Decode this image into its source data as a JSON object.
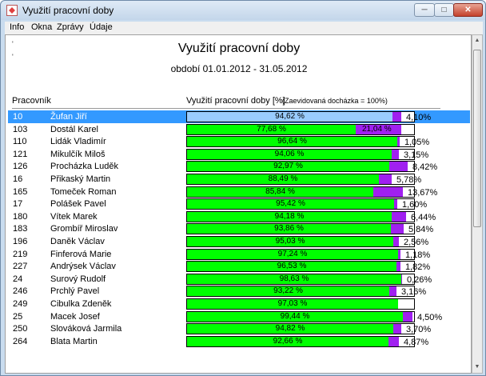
{
  "window": {
    "title": "Využití pracovní doby",
    "min_label": "─",
    "max_label": "□",
    "close_label": "✕"
  },
  "menu": {
    "items": [
      "Info",
      "Okna",
      "Zprávy",
      "Údaje"
    ]
  },
  "report": {
    "title": "Využití pracovní doby",
    "period": "období 01.01.2012 - 31.05.2012",
    "tick_marks": [
      "'",
      "'"
    ],
    "col_worker": "Pracovník",
    "col_usage": "Využití pracovní doby [%]",
    "col_note": "(Zaevidovaná docházka = 100%)"
  },
  "colors": {
    "worked": "#00ff00",
    "rest": "#a020f0",
    "selected_row": "#3399ff",
    "selected_bar": "#99ccff"
  },
  "rows": [
    {
      "id": "10",
      "name": "Žufan Jiří",
      "worked": 94.62,
      "worked_label": "94,62 %",
      "rest": 4.1,
      "rest_label": "4,10%",
      "rest_inside": "",
      "selected": true
    },
    {
      "id": "103",
      "name": "Dostál Karel",
      "worked": 77.68,
      "worked_label": "77,68 %",
      "rest": 21.04,
      "rest_label": "",
      "rest_inside": "21,04 %",
      "selected": false
    },
    {
      "id": "110",
      "name": "Lidák Vladimír",
      "worked": 96.64,
      "worked_label": "96,64 %",
      "rest": 1.05,
      "rest_label": "1,05%",
      "rest_inside": "",
      "selected": false
    },
    {
      "id": "121",
      "name": "Mikulčík Miloš",
      "worked": 94.06,
      "worked_label": "94,06 %",
      "rest": 3.15,
      "rest_label": "3,15%",
      "rest_inside": "",
      "selected": false
    },
    {
      "id": "126",
      "name": "Procházka Luděk",
      "worked": 92.97,
      "worked_label": "92,97 %",
      "rest": 8.42,
      "rest_label": "8,42%",
      "rest_inside": "",
      "selected": false
    },
    {
      "id": "16",
      "name": "Přikaský Martin",
      "worked": 88.49,
      "worked_label": "88,49 %",
      "rest": 5.78,
      "rest_label": "5,78%",
      "rest_inside": "",
      "selected": false
    },
    {
      "id": "165",
      "name": "Tomeček Roman",
      "worked": 85.84,
      "worked_label": "85,84 %",
      "rest": 13.67,
      "rest_label": "13,67%",
      "rest_inside": "",
      "selected": false
    },
    {
      "id": "17",
      "name": "Polášek Pavel",
      "worked": 95.42,
      "worked_label": "95,42 %",
      "rest": 1.6,
      "rest_label": "1,60%",
      "rest_inside": "",
      "selected": false
    },
    {
      "id": "180",
      "name": "Vítek Marek",
      "worked": 94.18,
      "worked_label": "94,18 %",
      "rest": 6.44,
      "rest_label": "6,44%",
      "rest_inside": "",
      "selected": false
    },
    {
      "id": "183",
      "name": "Grombíř Miroslav",
      "worked": 93.86,
      "worked_label": "93,86 %",
      "rest": 5.84,
      "rest_label": "5,84%",
      "rest_inside": "",
      "selected": false
    },
    {
      "id": "196",
      "name": "Daněk Václav",
      "worked": 95.03,
      "worked_label": "95,03 %",
      "rest": 2.56,
      "rest_label": "2,56%",
      "rest_inside": "",
      "selected": false
    },
    {
      "id": "219",
      "name": "Finferová Marie",
      "worked": 97.24,
      "worked_label": "97,24 %",
      "rest": 1.18,
      "rest_label": "1,18%",
      "rest_inside": "",
      "selected": false
    },
    {
      "id": "227",
      "name": "Andrýsek Václav",
      "worked": 96.53,
      "worked_label": "96,53 %",
      "rest": 1.82,
      "rest_label": "1,82%",
      "rest_inside": "",
      "selected": false
    },
    {
      "id": "24",
      "name": "Surový Rudolf",
      "worked": 98.63,
      "worked_label": "98,63 %",
      "rest": 0.26,
      "rest_label": "0,26%",
      "rest_inside": "",
      "selected": false
    },
    {
      "id": "246",
      "name": "Prchlý Pavel",
      "worked": 93.22,
      "worked_label": "93,22 %",
      "rest": 3.16,
      "rest_label": "3,16%",
      "rest_inside": "",
      "selected": false
    },
    {
      "id": "249",
      "name": "Cibulka Zdeněk",
      "worked": 97.03,
      "worked_label": "97,03 %",
      "rest": 0,
      "rest_label": "",
      "rest_inside": "",
      "selected": false
    },
    {
      "id": "25",
      "name": "Macek Josef",
      "worked": 99.44,
      "worked_label": "99,44 %",
      "rest": 4.5,
      "rest_label": "4,50%",
      "rest_inside": "",
      "selected": false
    },
    {
      "id": "250",
      "name": "Slováková Jarmila",
      "worked": 94.82,
      "worked_label": "94,82 %",
      "rest": 3.7,
      "rest_label": "3,70%",
      "rest_inside": "",
      "selected": false
    },
    {
      "id": "264",
      "name": "Blata Martin",
      "worked": 92.66,
      "worked_label": "92,66 %",
      "rest": 4.87,
      "rest_label": "4,87%",
      "rest_inside": "",
      "selected": false
    }
  ]
}
